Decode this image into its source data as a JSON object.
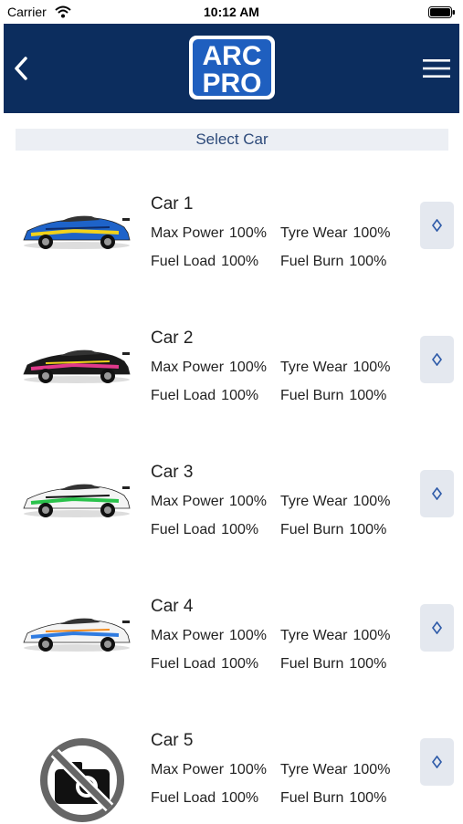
{
  "status_bar": {
    "carrier": "Carrier",
    "time": "10:12 AM"
  },
  "header": {
    "logo_line1": "ARC",
    "logo_line2": "PRO",
    "background": "#0c2d5e",
    "back_icon": "chevron-left-icon",
    "menu_icon": "hamburger-icon"
  },
  "select_bar": {
    "label": "Select Car"
  },
  "stat_labels": {
    "max_power": "Max Power",
    "tyre_wear": "Tyre Wear",
    "fuel_load": "Fuel Load",
    "fuel_burn": "Fuel Burn"
  },
  "cars": [
    {
      "name": "Car 1",
      "max_power": "100%",
      "tyre_wear": "100%",
      "fuel_load": "100%",
      "fuel_burn": "100%",
      "image": "blue-yellow-race-car"
    },
    {
      "name": "Car 2",
      "max_power": "100%",
      "tyre_wear": "100%",
      "fuel_load": "100%",
      "fuel_burn": "100%",
      "image": "black-multicolor-race-car"
    },
    {
      "name": "Car 3",
      "max_power": "100%",
      "tyre_wear": "100%",
      "fuel_load": "100%",
      "fuel_burn": "100%",
      "image": "white-green-race-car"
    },
    {
      "name": "Car 4",
      "max_power": "100%",
      "tyre_wear": "100%",
      "fuel_load": "100%",
      "fuel_burn": "100%",
      "image": "white-blue-race-car"
    },
    {
      "name": "Car 5",
      "max_power": "100%",
      "tyre_wear": "100%",
      "fuel_load": "100%",
      "fuel_burn": "100%",
      "image": "no-photo-icon"
    }
  ]
}
